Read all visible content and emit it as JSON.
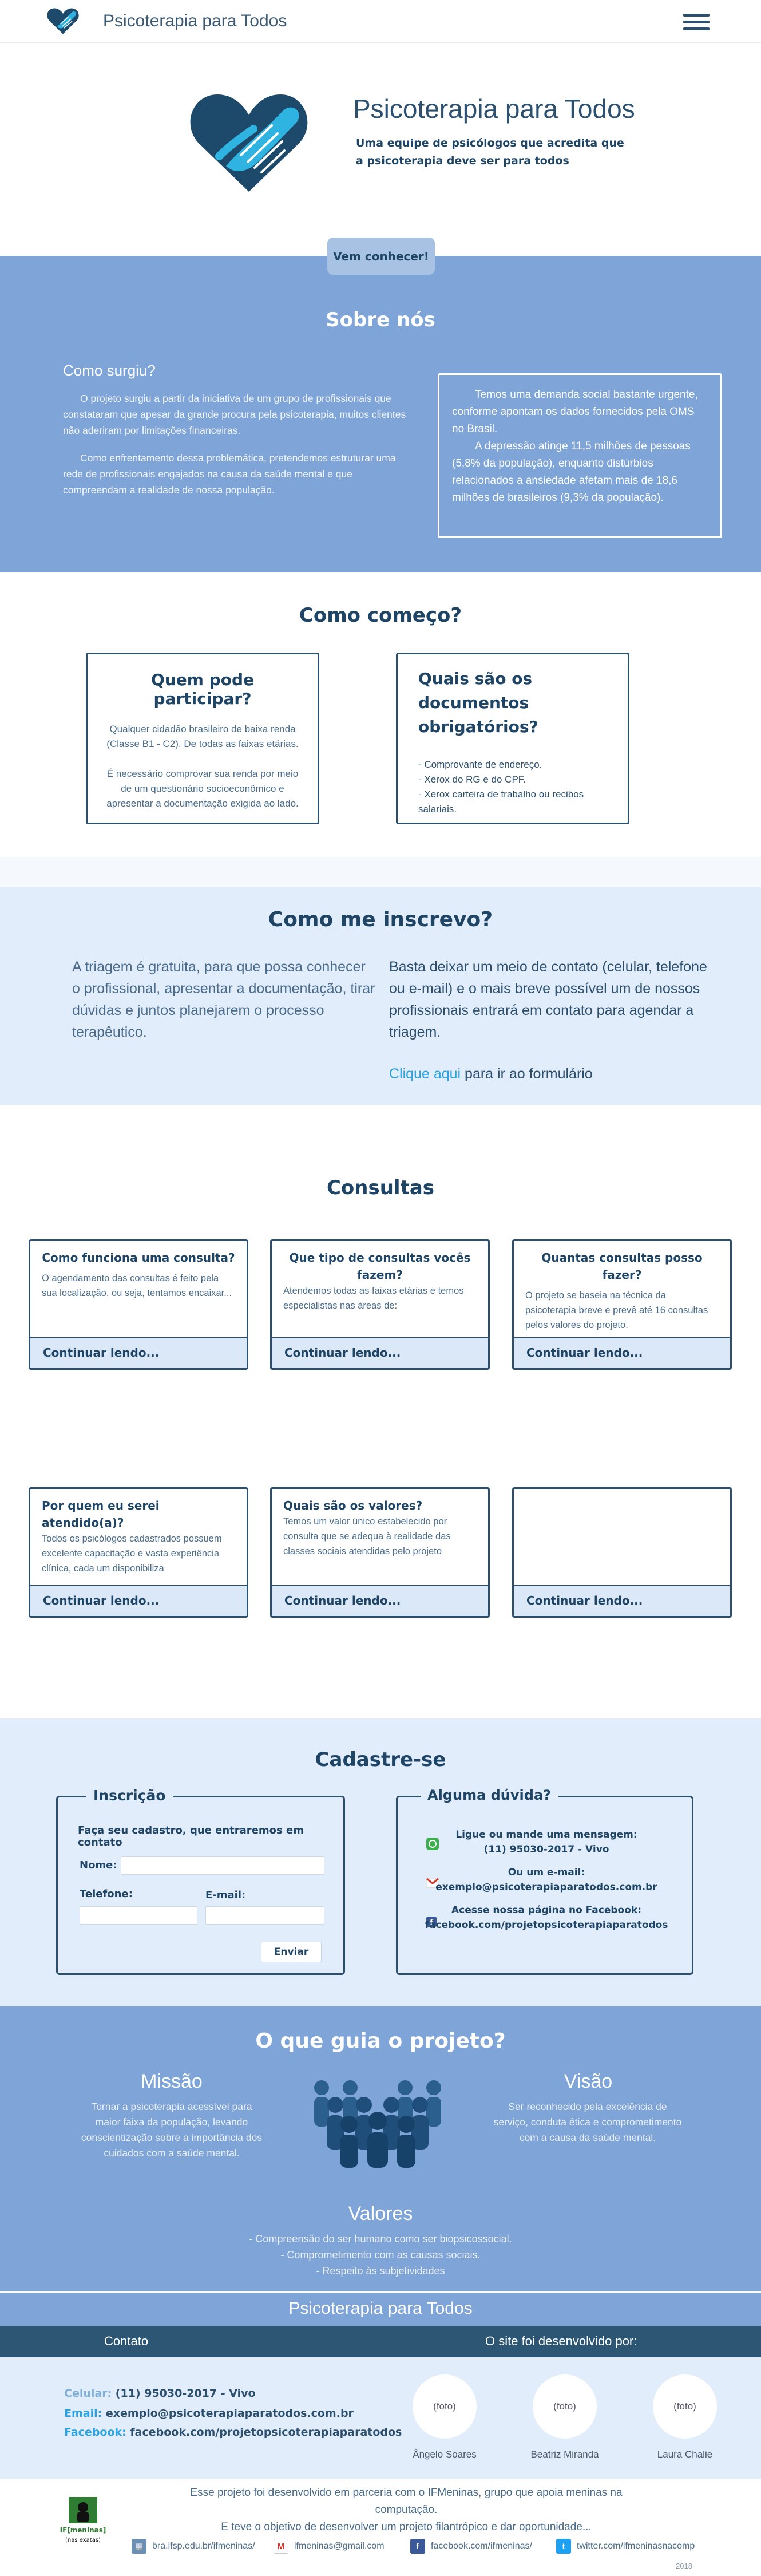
{
  "header": {
    "brand": "Psicoterapia para Todos"
  },
  "hero": {
    "title": "Psicoterapia para Todos",
    "tagline": "Uma equipe de psicólogos que acredita que a psicoterapia deve ser para todos",
    "cta": "Vem conhecer!"
  },
  "sobre": {
    "title": "Sobre nós",
    "subtitle": "Como surgiu?",
    "p1": "O projeto surgiu a partir da iniciativa de um grupo de profissionais que constataram que apesar da grande procura pela psicoterapia, muitos clientes não aderiram por limitações financeiras.",
    "p2": "Como enfrentamento dessa problemática, pretendemos estruturar uma rede de profissionais engajados na causa da saúde mental e que compreendam a realidade de nossa população.",
    "box_p1": "Temos uma demanda social bastante urgente, conforme apontam os dados fornecidos pela OMS no Brasil.",
    "box_p2": "A depressão atinge 11,5 milhões de pessoas (5,8% da população), enquanto distúrbios relacionados a ansiedade afetam mais de 18,6 milhões de brasileiros (9,3% da população)."
  },
  "comeco": {
    "title": "Como começo?",
    "card_a": {
      "title": "Quem pode participar?",
      "p1": "Qualquer cidadão brasileiro de baixa renda (Classe B1 - C2). De todas as faixas etárias.",
      "p2": "É necessário comprovar sua renda por meio de um questionário socioeconômico e apresentar a documentação exigida ao lado."
    },
    "card_b": {
      "title": "Quais são os documentos obrigatórios?",
      "items": [
        "- Comprovante de endereço.",
        "- Xerox do RG e do CPF.",
        "- Xerox carteira de trabalho ou recibos salariais."
      ]
    }
  },
  "inscreve": {
    "title": "Como me inscrevo?",
    "left": "A triagem é gratuita, para que possa conhecer o profissional, apresentar a documentação, tirar dúvidas e juntos planejarem o processo terapêutico.",
    "right": "Basta deixar um meio de contato (celular, telefone ou e-mail) e o mais breve possível um de nossos profissionais entrará em contato para agendar a triagem.",
    "link": "Clique aqui",
    "link_suffix": " para ir ao formulário"
  },
  "consultas": {
    "title": "Consultas",
    "more_label": "Continuar lendo...",
    "cards": [
      {
        "title": "Como funciona uma consulta?",
        "text": "O agendamento das consultas é feito pela sua localização, ou seja, tentamos encaixar..."
      },
      {
        "title": "Que tipo de consultas vocês fazem?",
        "text": "Atendemos todas as faixas etárias e temos especialistas nas áreas de:"
      },
      {
        "title": "Quantas consultas posso fazer?",
        "text": "O projeto se baseia na técnica da psicoterapia breve e prevê até 16 consultas pelos valores do projeto."
      },
      {
        "title": "Por quem eu serei atendido(a)?",
        "text": "Todos os psicólogos cadastrados possuem excelente capacitação e vasta experiência clínica, cada um disponibiliza"
      },
      {
        "title": "Quais são os valores?",
        "text": "Temos um valor único estabelecido por consulta que se adequa à realidade das classes sociais atendidas pelo projeto"
      },
      {
        "title": "",
        "text": ""
      }
    ]
  },
  "cadastre": {
    "title": "Cadastre-se",
    "form": {
      "legend": "Inscrição",
      "intro": "Faça seu cadastro, que entraremos em contato",
      "name_label": "Nome:",
      "phone_label": "Telefone:",
      "email_label": "E-mail:",
      "send": "Enviar"
    },
    "duvida": {
      "legend": "Alguma dúvida?",
      "l1": "Ligue ou mande uma mensagem:",
      "l1v": "(11) 95030-2017 - Vivo",
      "l2": "Ou um e-mail:",
      "l2v": "exemplo@psicoterapiaparatodos.com.br",
      "l3": "Acesse nossa página no Facebook:",
      "l3v": "facebook.com/projetopsicoterapiaparatodos"
    }
  },
  "guia": {
    "title": "O que guia o projeto?",
    "missao_h": "Missão",
    "missao_t": "Tornar a psicoterapia acessível para maior faixa da população, levando conscientização sobre a importância dos cuidados com a saúde mental.",
    "visao_h": "Visão",
    "visao_t": "Ser reconhecido pela excelência de serviço, conduta ética e comprometimento com a causa da saúde mental.",
    "valores_h": "Valores",
    "valores": [
      "- Compreensão do ser humano como ser biopsicossocial.",
      "- Comprometimento com as causas sociais.",
      "- Respeito às subjetividades"
    ]
  },
  "footer": {
    "title": "Psicoterapia para Todos",
    "contato": "Contato",
    "dev_heading": "O site foi desenvolvido por:",
    "cel_k": "Celular:",
    "cel_v": "(11) 95030-2017 - Vivo",
    "email_k": "Email:",
    "email_v": "exemplo@psicoterapiaparatodos.com.br",
    "fb_k": "Facebook:",
    "fb_v": "facebook.com/projetopsicoterapiaparatodos",
    "devs": [
      {
        "photo": "(foto)",
        "name": "Ângelo Soares"
      },
      {
        "photo": "(foto)",
        "name": "Beatriz Miranda"
      },
      {
        "photo": "(foto)",
        "name": "Laura Chalie"
      }
    ],
    "about1": "Esse projeto foi desenvolvido em parceria com o IFMeninas, grupo que apoia meninas na computação.",
    "about2": "E teve o objetivo de desenvolver um projeto filantrópico e dar oportunidade...",
    "ifm_label": "IF[meninas]",
    "ifm_sub": "(nas exatas)",
    "social": [
      {
        "icon": "site-icon",
        "text": "bra.ifsp.edu.br/ifmeninas/"
      },
      {
        "icon": "gmail-icon",
        "text": "ifmeninas@gmail.com"
      },
      {
        "icon": "facebook-icon",
        "text": "facebook.com/ifmeninas/"
      },
      {
        "icon": "twitter-icon",
        "text": "twitter.com/ifmeninasnacomp"
      }
    ],
    "copy": "2018"
  },
  "colors": {
    "blue": "#7ea4d8",
    "navy": "#2c4f6e",
    "light": "#e2edfc",
    "cyan": "#2aa1e0"
  }
}
